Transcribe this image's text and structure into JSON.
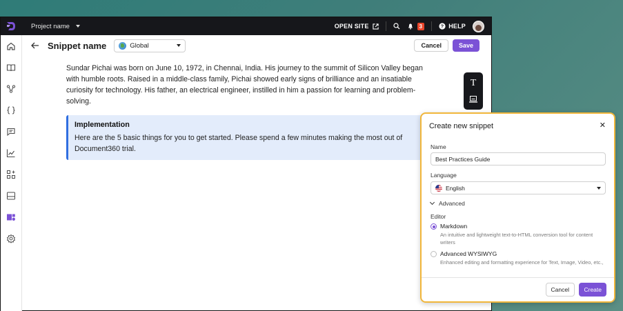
{
  "topbar": {
    "project_name": "Project name",
    "open_site": "OPEN SITE",
    "notification_count": "3",
    "help": "HELP"
  },
  "header": {
    "title": "Snippet name",
    "scope": "Global",
    "cancel": "Cancel",
    "save": "Save"
  },
  "content": {
    "paragraph": "Sundar Pichai was born on June 10, 1972, in Chennai, India. His journey to the summit of Silicon Valley began with humble roots. Raised in a middle-class family, Pichai showed early signs of brilliance and an insatiable curiosity for technology. His father, an electrical engineer, instilled in him a passion for learning and problem-solving.",
    "callout_title": "Implementation",
    "callout_text": "Here are the 5 basic things for you to get started. Please spend a few minutes making the most out of Document360 trial."
  },
  "toolbar": {
    "text_tool_glyph": "T"
  },
  "modal": {
    "title": "Create new snippet",
    "close_glyph": "✕",
    "name_label": "Name",
    "name_value": "Best Practices Guide",
    "language_label": "Language",
    "language_value": "English",
    "advanced_label": "Advanced",
    "editor_label": "Editor",
    "options": [
      {
        "title": "Markdown",
        "desc": "An intuitive and lightweight text-to-HTML conversion tool for content writers",
        "selected": true
      },
      {
        "title": "Advanced WYSIWYG",
        "desc": "Enhanced editing and formatting experience for Text, Image, Video, etc.,",
        "selected": false
      }
    ],
    "cancel": "Cancel",
    "create": "Create"
  },
  "colors": {
    "accent": "#7b52d6",
    "topbar": "#16171b",
    "callout_bg": "#e3ecfb",
    "callout_border": "#2f6ee0",
    "modal_border": "#f1b63a",
    "badge": "#e9452b"
  },
  "icons": {
    "sidebar": [
      "home-icon",
      "book-icon",
      "workflow-icon",
      "code-braces-icon",
      "comment-icon",
      "analytics-icon",
      "apps-icon",
      "drive-icon",
      "snippet-icon",
      "settings-icon"
    ]
  }
}
